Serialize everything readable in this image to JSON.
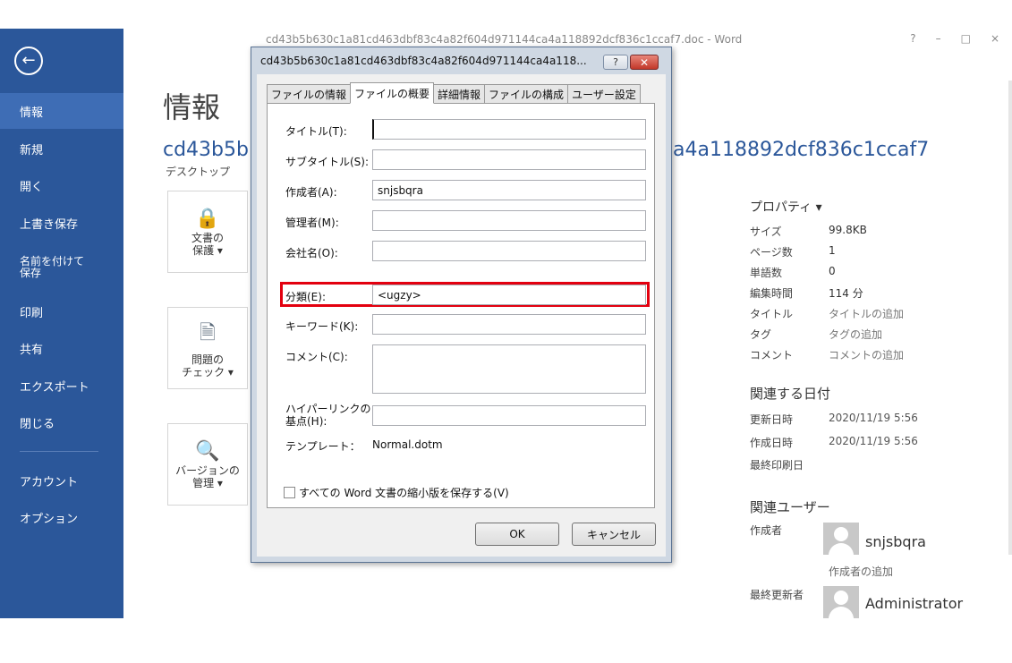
{
  "window": {
    "title": "cd43b5b630c1a81cd463dbf83c4a82f604d971144ca4a118892dcf836c1ccaf7.doc - Word",
    "controls": [
      "?",
      "–",
      "□",
      "×"
    ]
  },
  "sidebar": {
    "back_icon": "back-arrow-icon",
    "items": [
      {
        "label": "情報"
      },
      {
        "label": "新規"
      },
      {
        "label": "開く"
      },
      {
        "label": "上書き保存"
      },
      {
        "label": "名前を付けて\n保存"
      },
      {
        "label": "印刷"
      },
      {
        "label": "共有"
      },
      {
        "label": "エクスポート"
      },
      {
        "label": "閉じる"
      },
      {
        "label": "アカウント"
      },
      {
        "label": "オプション"
      }
    ]
  },
  "main": {
    "page_title": "情報",
    "doc_name_left": "cd43b5b",
    "doc_name_right": "a4a118892dcf836c1ccaf7",
    "location": "デスクトップ",
    "tiles": [
      {
        "label": "文書の\n保護 ▾",
        "icon": "lock-key-icon"
      },
      {
        "label": "問題の\nチェック ▾",
        "icon": "inspect-document-icon"
      },
      {
        "label": "バージョンの\n管理 ▾",
        "icon": "manage-versions-icon"
      }
    ]
  },
  "properties": {
    "header": "プロパティ ▾",
    "rows": [
      {
        "key": "サイズ",
        "value": "99.8KB"
      },
      {
        "key": "ページ数",
        "value": "1"
      },
      {
        "key": "単語数",
        "value": "0"
      },
      {
        "key": "編集時間",
        "value": "114 分"
      },
      {
        "key": "タイトル",
        "value": "タイトルの追加"
      },
      {
        "key": "タグ",
        "value": "タグの追加"
      },
      {
        "key": "コメント",
        "value": "コメントの追加"
      }
    ],
    "dates_header": "関連する日付",
    "dates": [
      {
        "key": "更新日時",
        "value": "2020/11/19 5:56"
      },
      {
        "key": "作成日時",
        "value": "2020/11/19 5:56"
      },
      {
        "key": "最終印刷日",
        "value": ""
      }
    ],
    "people_header": "関連ユーザー",
    "author_label": "作成者",
    "author_name": "snjsbqra",
    "add_author": "作成者の追加",
    "last_modified_label": "最終更新者",
    "last_modified_name": "Administrator"
  },
  "dialog": {
    "title": "cd43b5b630c1a81cd463dbf83c4a82f604d971144ca4a118...",
    "help_label": "?",
    "close_label": "✕",
    "tabs": [
      "ファイルの情報",
      "ファイルの概要",
      "詳細情報",
      "ファイルの構成",
      "ユーザー設定"
    ],
    "active_tab": 1,
    "fields": {
      "title_label": "タイトル(T):",
      "title_value": "",
      "subtitle_label": "サブタイトル(S):",
      "subtitle_value": "",
      "author_label": "作成者(A):",
      "author_value": "snjsbqra",
      "manager_label": "管理者(M):",
      "manager_value": "",
      "company_label": "会社名(O):",
      "company_value": "",
      "category_label": "分類(E):",
      "category_value": "<ugzy>",
      "keywords_label": "キーワード(K):",
      "keywords_value": "",
      "comments_label": "コメント(C):",
      "comments_value": "",
      "hyperlink_label": "ハイパーリンクの\n基点(H):",
      "hyperlink_value": "",
      "template_label": "テンプレート：",
      "template_value": "Normal.dotm"
    },
    "thumbnail_checkbox": "すべての Word 文書の縮小版を保存する(V)",
    "ok_label": "OK",
    "cancel_label": "キャンセル"
  }
}
